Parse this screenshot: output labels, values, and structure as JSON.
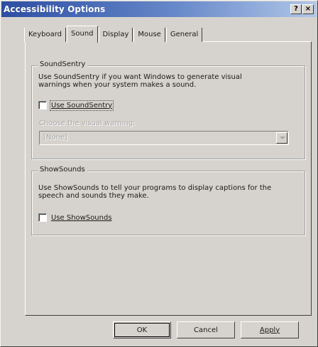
{
  "window": {
    "title": "Accessibility Options",
    "help_glyph": "?",
    "close_glyph": "×"
  },
  "tabs": [
    {
      "label": "Keyboard"
    },
    {
      "label": "Sound"
    },
    {
      "label": "Display"
    },
    {
      "label": "Mouse"
    },
    {
      "label": "General"
    }
  ],
  "soundsentry": {
    "title": "SoundSentry",
    "description": "Use SoundSentry if you want Windows to generate visual warnings when your system makes a sound.",
    "checkbox_label": "Use SoundSentry",
    "visual_warning_label": "Choose the visual warning:",
    "visual_warning_value": "[None]"
  },
  "showsounds": {
    "title": "ShowSounds",
    "description": "Use ShowSounds to tell your programs to display captions for the speech and sounds they make.",
    "checkbox_label": "Use ShowSounds"
  },
  "buttons": {
    "ok": "OK",
    "cancel": "Cancel",
    "apply": "Apply"
  }
}
